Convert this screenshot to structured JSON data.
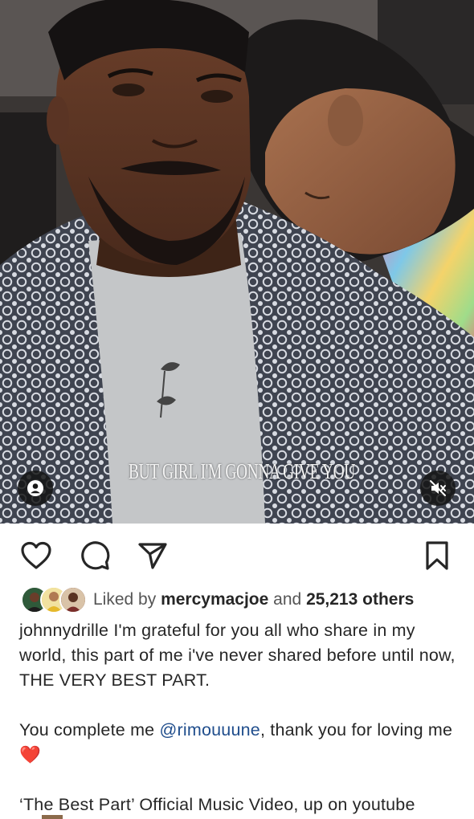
{
  "video": {
    "lyric_text": "BUT GIRL I'M GONNA GIVE YOU",
    "tag_icon": "person-tag-icon",
    "mute_icon": "speaker-muted-icon"
  },
  "actions": {
    "like_icon": "heart-outline-icon",
    "comment_icon": "comment-bubble-icon",
    "share_icon": "paper-plane-icon",
    "save_icon": "bookmark-outline-icon"
  },
  "likes": {
    "prefix": "Liked by",
    "user": "mercymacjoe",
    "connector": "and",
    "count": "25,213 others"
  },
  "caption": {
    "author": "johnnydrille",
    "line1": " I'm grateful for you all who share in my world, this part of me i've never shared before until now, THE VERY BEST PART.",
    "line2_pre": "You complete me ",
    "mention": "@rimouuune",
    "line2_post": ", thank you for loving me ",
    "heart": "❤️",
    "line3": "‘The Best Part’ Official Music Video, up on youtube"
  },
  "colors": {
    "mention": "#1f4d8c",
    "heart": "#e0242b",
    "text": "#262626"
  }
}
